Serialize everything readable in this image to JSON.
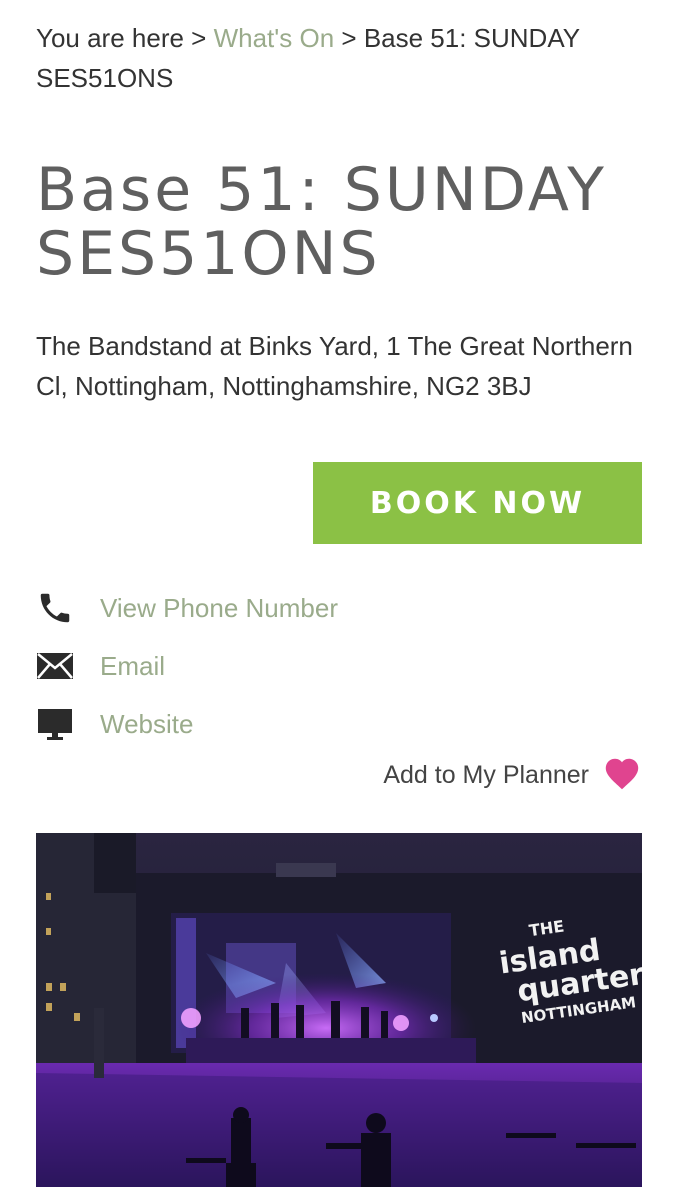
{
  "breadcrumb": {
    "prefix": "You are here >",
    "whats_on": "What's On",
    "separator": ">",
    "current": "Base 51: SUNDAY SES51ONS"
  },
  "event": {
    "title_line1": "Base 51: SUNDAY",
    "title_line2": "SES51ONS",
    "address": "The Bandstand at Binks Yard, 1 The Great Northern Cl, Nottingham, Nottinghamshire, NG2 3BJ"
  },
  "book_button": "BOOK NOW",
  "contacts": [
    {
      "label": "View Phone Number",
      "icon": "phone-icon"
    },
    {
      "label": "Email",
      "icon": "envelope-icon"
    },
    {
      "label": "Website",
      "icon": "monitor-icon"
    }
  ],
  "planner": {
    "label": "Add to My Planner",
    "icon": "heart-icon",
    "icon_color": "#e0448f"
  },
  "photo": {
    "logo_the": "THE",
    "logo_island": "island",
    "logo_quarter": "quarter",
    "logo_city": "NOTTINGHAM"
  },
  "colors": {
    "link": "#9aab8b",
    "accent": "#8bc145",
    "title": "#5f5f5f"
  }
}
